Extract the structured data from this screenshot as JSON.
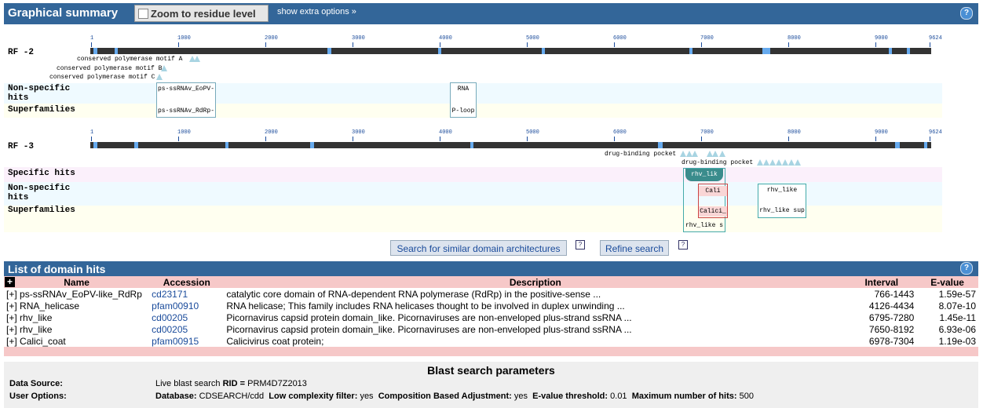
{
  "summary_bar": {
    "title": "Graphical summary",
    "zoom_label": "Zoom to residue level",
    "extra_options": "show extra options »",
    "help_glyph": "?"
  },
  "axis_ticks": [
    "1",
    "1000",
    "2000",
    "3000",
    "4000",
    "5000",
    "6000",
    "7000",
    "8000",
    "9000",
    "9624"
  ],
  "rf2": {
    "label": "RF -2",
    "motifs": [
      "conserved polymerase motif A",
      "conserved polymerase motif B",
      "conserved polymerase motif C"
    ],
    "rows": {
      "nonspecific": "Non-specific hits",
      "superfamilies": "Superfamilies"
    },
    "nonspecific_boxes": [
      "ps-ssRNAv_EoPV-",
      "RNA"
    ],
    "superfamily_boxes": [
      "ps-ssRNAv_RdRp-",
      "P-loop"
    ]
  },
  "rf3": {
    "label": "RF -3",
    "features": [
      "drug-binding pocket",
      "drug-binding pocket"
    ],
    "rows": {
      "specific": "Specific hits",
      "nonspecific": "Non-specific hits",
      "superfamilies": "Superfamilies"
    },
    "specific_boxes": [
      "rhv_lik"
    ],
    "nonspecific_boxes": [
      "Cali",
      "rhv_like"
    ],
    "superfamily_boxes": [
      "Calici_",
      "rhv_like sup",
      "rhv_like s"
    ]
  },
  "buttons": {
    "similar": "Search for similar domain architectures",
    "refine": "Refine search",
    "help_glyph": "?"
  },
  "list_bar": {
    "title": "List of domain hits",
    "help_glyph": "?"
  },
  "table": {
    "toggle_glyph": "+",
    "headers": [
      "Name",
      "Accession",
      "Description",
      "Interval",
      "E-value"
    ],
    "rows": [
      {
        "toggle": "[+]",
        "name": "ps-ssRNAv_EoPV-like_RdRp",
        "acc": "cd23171",
        "desc": "catalytic core domain of RNA-dependent RNA polymerase (RdRp) in the positive-sense ...",
        "interval": "766-1443",
        "evalue": "1.59e-57"
      },
      {
        "toggle": "[+]",
        "name": "RNA_helicase",
        "acc": "pfam00910",
        "desc": "RNA helicase; This family includes RNA helicases thought to be involved in duplex unwinding ...",
        "interval": "4126-4434",
        "evalue": "8.07e-10"
      },
      {
        "toggle": "[+]",
        "name": "rhv_like",
        "acc": "cd00205",
        "desc": "Picornavirus capsid protein domain_like. Picornaviruses are non-enveloped plus-strand ssRNA ...",
        "interval": "6795-7280",
        "evalue": "1.45e-11"
      },
      {
        "toggle": "[+]",
        "name": "rhv_like",
        "acc": "cd00205",
        "desc": "Picornavirus capsid protein domain_like. Picornaviruses are non-enveloped plus-strand ssRNA ...",
        "interval": "7650-8192",
        "evalue": "6.93e-06"
      },
      {
        "toggle": "[+]",
        "name": "Calici_coat",
        "acc": "pfam00915",
        "desc": "Calicivirus coat protein;",
        "interval": "6978-7304",
        "evalue": "1.19e-03"
      }
    ]
  },
  "params": {
    "title": "Blast search parameters",
    "data_source_key": "Data Source:",
    "data_source_text": "Live blast search",
    "rid_key": "RID =",
    "rid_value": "PRM4D7Z2013",
    "user_options_key": "User Options:",
    "database_key": "Database:",
    "database_value": "CDSEARCH/cdd",
    "low_complexity_key": "Low complexity filter:",
    "low_complexity_value": "yes",
    "composition_key": "Composition Based Adjustment:",
    "composition_value": "yes",
    "evalue_key": "E-value threshold:",
    "evalue_value": "0.01",
    "maxhits_key": "Maximum number of hits:",
    "maxhits_value": "500"
  }
}
